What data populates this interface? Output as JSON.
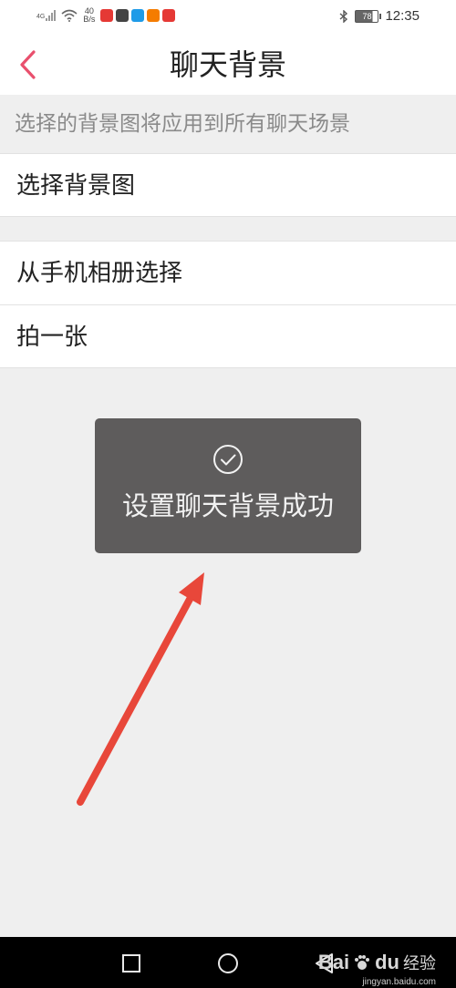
{
  "status_bar": {
    "network_label": "4G",
    "speed_value": "40",
    "speed_unit": "B/s",
    "battery_level": "78",
    "time": "12:35",
    "app_icons": [
      {
        "name": "app-red-icon",
        "color": "#e53935"
      },
      {
        "name": "app-dark-icon",
        "color": "#444444"
      },
      {
        "name": "app-blue-icon",
        "color": "#1e9be8"
      },
      {
        "name": "app-orange-icon",
        "color": "#f57c00"
      },
      {
        "name": "app-red-bar-icon",
        "color": "#e53935"
      }
    ]
  },
  "header": {
    "title": "聊天背景",
    "back_icon": "chevron-left-icon",
    "accent_color": "#e9506d"
  },
  "hint": "选择的背景图将应用到所有聊天场景",
  "menu": {
    "choose_background": "选择背景图",
    "from_album": "从手机相册选择",
    "take_photo": "拍一张"
  },
  "toast": {
    "icon": "check-circle-icon",
    "message": "设置聊天背景成功"
  },
  "annotation": {
    "arrow_color": "#e8473a"
  },
  "nav_bar": {
    "buttons": [
      "square-icon",
      "circle-icon",
      "triangle-back-icon"
    ]
  },
  "watermark": {
    "brand": "Bai",
    "brand2": "du",
    "label": "经验",
    "url": "jingyan.baidu.com"
  }
}
